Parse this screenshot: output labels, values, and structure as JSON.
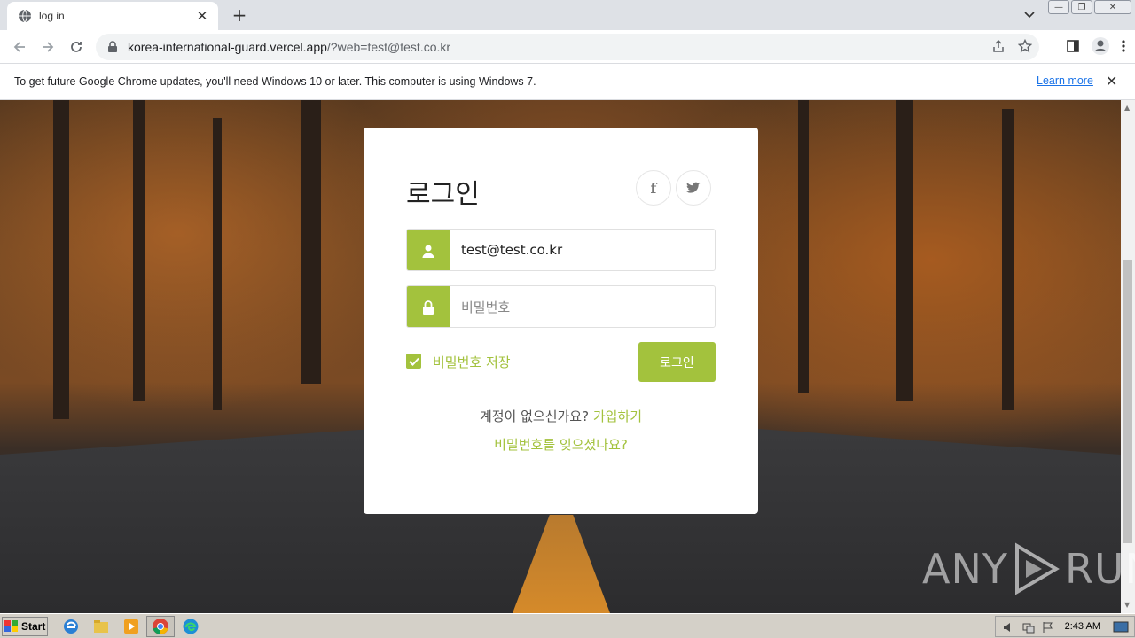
{
  "browser": {
    "tab_title": "log in",
    "url_host": "korea-international-guard.vercel.app",
    "url_path": "/?web=test@test.co.kr",
    "infobar_message": "To get future Google Chrome updates, you'll need Windows 10 or later. This computer is using Windows 7.",
    "infobar_link": "Learn more"
  },
  "login": {
    "title": "로그인",
    "email_value": "test@test.co.kr",
    "password_placeholder": "비밀번호",
    "remember_label": "비밀번호 저장",
    "remember_checked": true,
    "submit_label": "로그인",
    "no_account_text": "계정이 없으신가요?",
    "signup_link": "가입하기",
    "forgot_link": "비밀번호를 잊으셨나요?",
    "accent_color": "#a3c23d"
  },
  "watermark": {
    "left": "ANY",
    "right": "RUN"
  },
  "taskbar": {
    "start_label": "Start",
    "clock": "2:43 AM"
  },
  "icons": {
    "social": [
      "facebook-icon",
      "twitter-icon"
    ],
    "email": "user-icon",
    "password": "lock-icon"
  }
}
